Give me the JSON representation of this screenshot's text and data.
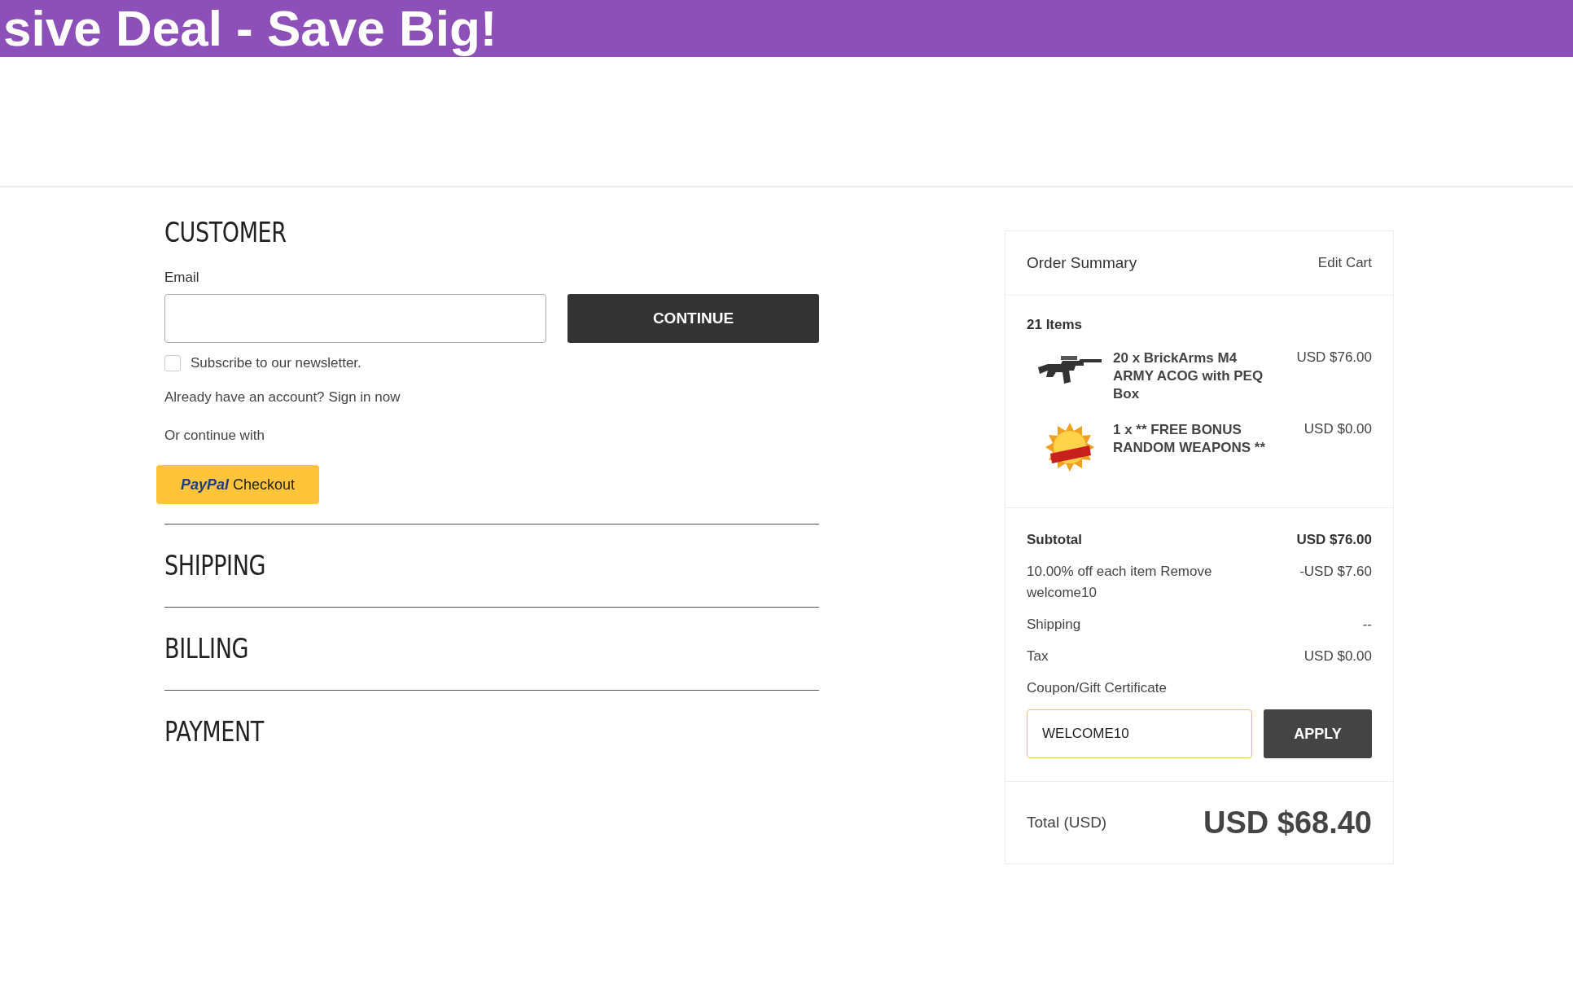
{
  "banner": {
    "text": "sive Deal - Save Big!"
  },
  "customer": {
    "heading": "CUSTOMER",
    "email_label": "Email",
    "continue_button": "CONTINUE",
    "newsletter": {
      "label": "Subscribe to our newsletter.",
      "checked": false
    },
    "account_text": "Already have an account?",
    "sign_in_link": "Sign in now",
    "or_text": "Or continue with",
    "paypal": {
      "brand": "PayPal",
      "label": "Checkout"
    }
  },
  "sections": [
    {
      "heading": "SHIPPING"
    },
    {
      "heading": "BILLING"
    },
    {
      "heading": "PAYMENT"
    }
  ],
  "order_summary": {
    "title": "Order Summary",
    "edit_link": "Edit Cart",
    "items_count": "21 Items",
    "items": [
      {
        "kind": "rifle",
        "name": "20 x BrickArms M4 ARMY ACOG with PEQ Box",
        "price": "USD $76.00"
      },
      {
        "kind": "bonus",
        "name": "1 x ** FREE BONUS RANDOM WEAPONS **",
        "price": "USD $0.00"
      }
    ],
    "subtotal": {
      "label": "Subtotal",
      "value": "USD $76.00"
    },
    "discount": {
      "text": "10.00% off each item",
      "link": "Remove",
      "code": "welcome10",
      "value": "-USD $7.60"
    },
    "shipping": {
      "label": "Shipping",
      "value": "--"
    },
    "tax": {
      "label": "Tax",
      "value": "USD $0.00"
    },
    "coupon": {
      "label": "Coupon/Gift Certificate",
      "value": "WELCOME10",
      "button": "APPLY"
    },
    "total": {
      "label": "Total (USD)",
      "value": "USD $68.40"
    }
  }
}
